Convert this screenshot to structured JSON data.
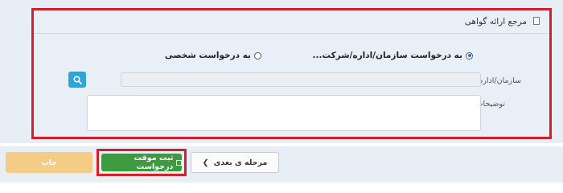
{
  "section": {
    "title": "مرجع ارائه گواهی",
    "options": [
      {
        "label": "به درخواست سازمان/اداره/شرکت...",
        "checked": true
      },
      {
        "label": "به درخواست شخصی",
        "checked": false
      }
    ],
    "fields": {
      "org_label": "سازمان/اداره/شرکت",
      "org_value": "",
      "notes_label": "توضیحات",
      "notes_value": ""
    }
  },
  "footer": {
    "print_label": "چاپ",
    "save_label": "ثبت موقت درخواست",
    "next_label": "مرحله ی بعدی"
  },
  "colors": {
    "highlight": "#d11f2b",
    "save_button": "#3d9a3f",
    "print_button": "#f4cc85",
    "search_button": "#2fa4d6"
  }
}
